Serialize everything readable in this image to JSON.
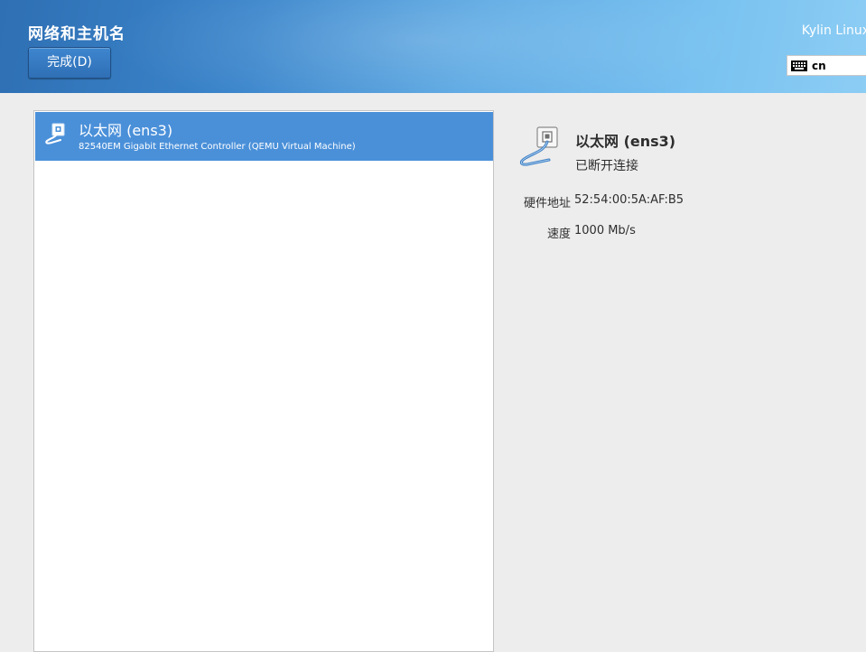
{
  "header": {
    "title": "网络和主机名",
    "done_label": "完成(D)",
    "product": "Kylin Linux",
    "keyboard_layout": "cn",
    "keyboard_icon": "keyboard-icon"
  },
  "devices": [
    {
      "name": "以太网 (ens3)",
      "description": "82540EM Gigabit Ethernet Controller (QEMU Virtual Machine)",
      "icon": "ethernet-cable-icon",
      "selected": true
    }
  ],
  "details": {
    "name": "以太网 (ens3)",
    "status": "已断开连接",
    "hardware_address_label": "硬件地址",
    "hardware_address": "52:54:00:5A:AF:B5",
    "speed_label": "速度",
    "speed": "1000 Mb/s"
  },
  "colors": {
    "header_gradient_start": "#2f6fb3",
    "header_gradient_end": "#8ccdf4",
    "selection": "#4a90d9",
    "background": "#ededed"
  }
}
